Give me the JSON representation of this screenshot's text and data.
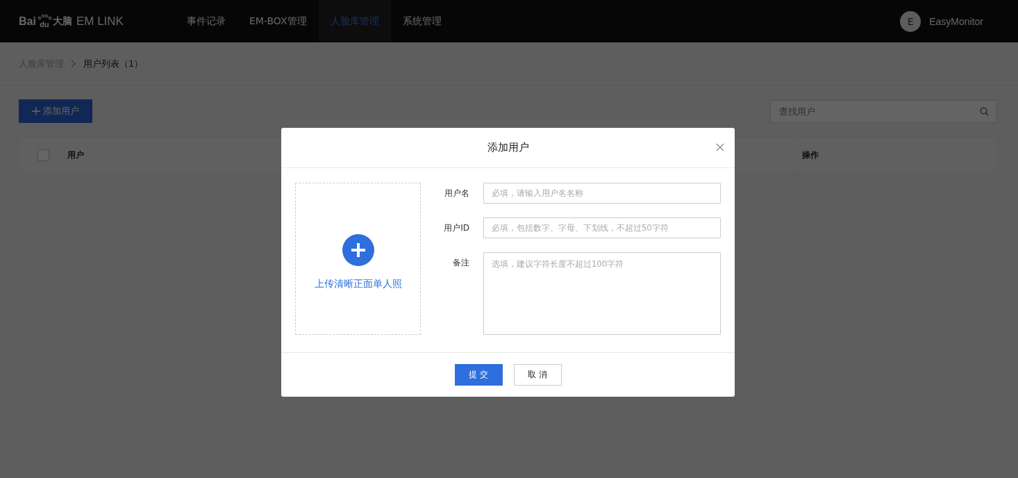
{
  "logo": {
    "left": "Bai",
    "mark": "du",
    "right": "大脑",
    "product": "EM LINK"
  },
  "nav": [
    {
      "label": "事件记录",
      "selected": false
    },
    {
      "label": "EM-BOX管理",
      "selected": false
    },
    {
      "label": "人脸库管理",
      "selected": true
    },
    {
      "label": "系统管理",
      "selected": false
    }
  ],
  "user": {
    "initial": "E",
    "name": "EasyMonitor"
  },
  "breadcrumb": [
    "人脸库管理",
    "用户列表（1）"
  ],
  "add_button": "添加用户",
  "search": {
    "placeholder": "查找用户"
  },
  "table": {
    "columns": [
      "用户",
      "操作"
    ],
    "select_all_checked": false
  },
  "dialog": {
    "title": "添加用户",
    "upload_label": "上传清晰正面单人照",
    "fields": [
      {
        "kind": "input",
        "label": "用户名",
        "placeholder": "必填，请输入用户名名称"
      },
      {
        "kind": "input",
        "label": "用户ID",
        "placeholder": "必填，包括数字、字母、下划线，不超过50字符"
      },
      {
        "kind": "textarea",
        "label": "备注",
        "placeholder": "选填，建议字符长度不超过100字符"
      }
    ],
    "buttons": [
      {
        "label": "提 交",
        "kind": "primary"
      },
      {
        "label": "取 消",
        "kind": "default"
      }
    ]
  }
}
